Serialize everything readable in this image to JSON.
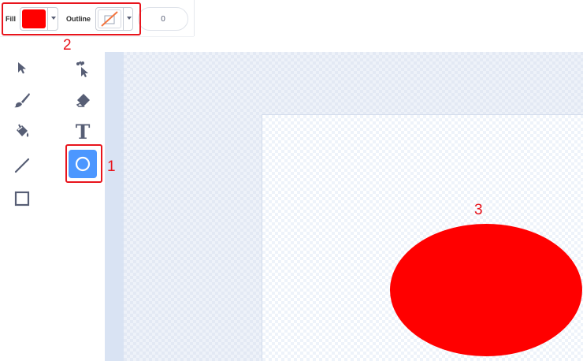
{
  "toolbar": {
    "fill_label": "Fill",
    "outline_label": "Outline",
    "fill_color": "#ff0000",
    "outline_color": "none",
    "outline_width": "0"
  },
  "tools": [
    {
      "name": "select-icon"
    },
    {
      "name": "reshape-icon"
    },
    {
      "name": "brush-icon"
    },
    {
      "name": "eraser-icon"
    },
    {
      "name": "fill-bucket-icon"
    },
    {
      "name": "text-icon",
      "glyph": "T"
    },
    {
      "name": "line-icon"
    },
    {
      "name": "circle-icon",
      "selected": true
    },
    {
      "name": "rectangle-icon"
    }
  ],
  "canvas": {
    "shape": "ellipse",
    "shape_color": "#ff0000"
  },
  "annotations": {
    "tool_marker": "1",
    "toolbar_marker": "2",
    "shape_marker": "3",
    "color": "#e8141c"
  }
}
